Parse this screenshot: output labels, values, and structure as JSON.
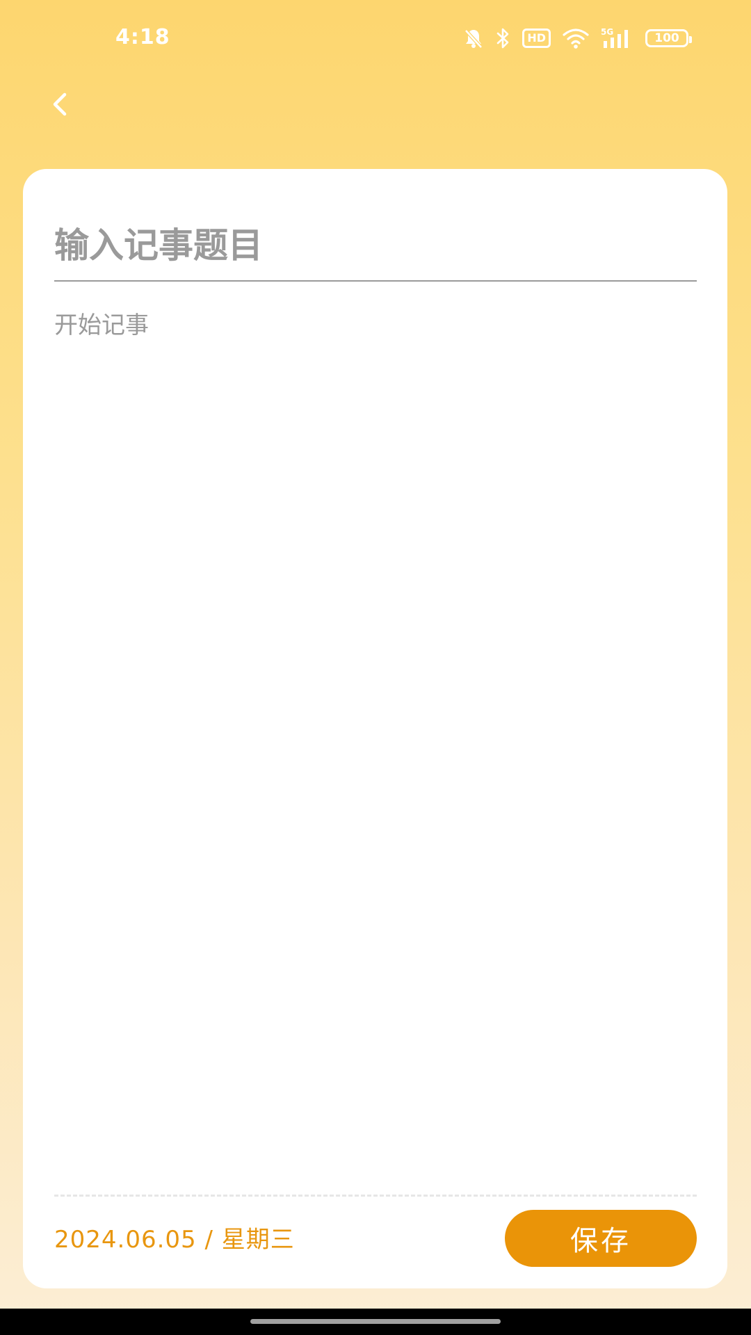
{
  "status_bar": {
    "time": "4:18",
    "hd_label": "HD",
    "network_label": "5G",
    "battery_level": "100",
    "icons": [
      "bell-off-icon",
      "bluetooth-icon",
      "hd-icon",
      "wifi-icon",
      "signal-5g-icon",
      "battery-icon"
    ]
  },
  "header": {
    "back_icon": "chevron-left-icon"
  },
  "note": {
    "title_placeholder": "输入记事题目",
    "title_value": "",
    "content_placeholder": "开始记事",
    "content_value": "",
    "date_text": "2024.06.05 / 星期三",
    "save_label": "保存"
  },
  "colors": {
    "accent": "#ea9408",
    "date_text": "#e8960f",
    "background_top": "#fdd66f",
    "background_bottom": "#fceed6",
    "placeholder": "#9a9a9a"
  }
}
